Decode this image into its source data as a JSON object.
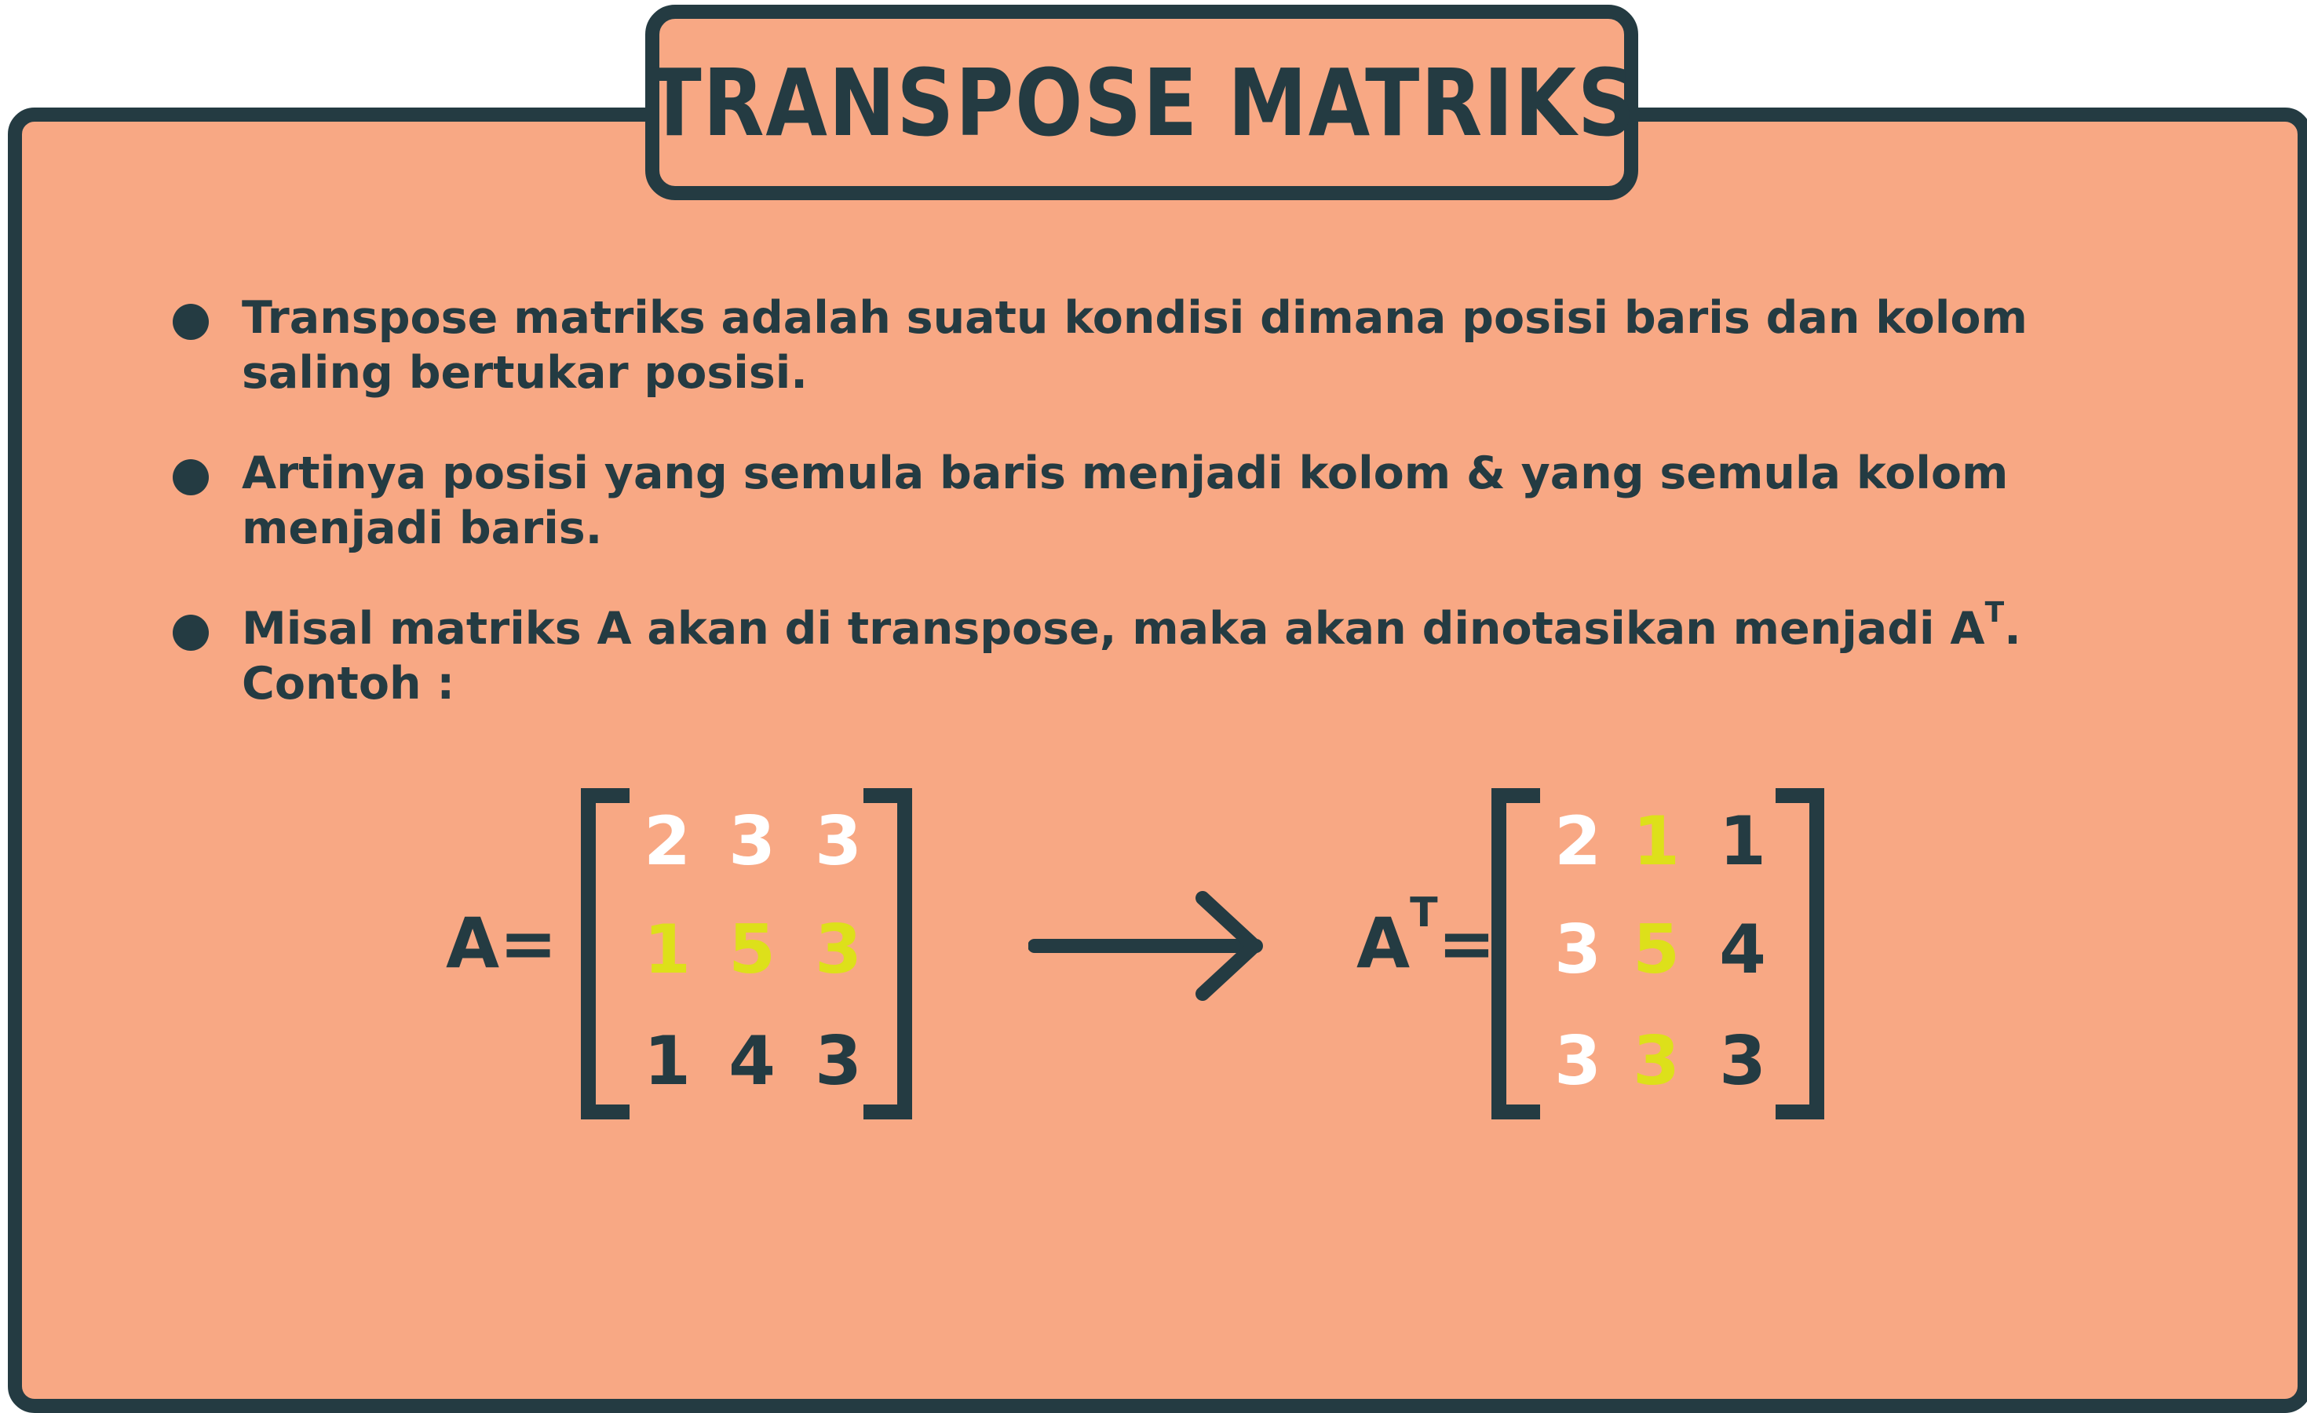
{
  "title": "TRANSPOSE MATRIKS",
  "bullets": [
    {
      "text": "Transpose matriks adalah suatu kondisi dimana posisi baris dan kolom saling bertukar posisi."
    },
    {
      "text": "Artinya posisi yang semula baris menjadi kolom & yang semula kolom menjadi baris."
    },
    {
      "text_before": "Misal matriks A akan di transpose, maka akan dinotasikan menjadi A",
      "superscript": "T",
      "text_after": ". Contoh :"
    }
  ],
  "matrix_a": {
    "label": "A=",
    "rows": [
      [
        "2",
        "3",
        "3"
      ],
      [
        "1",
        "5",
        "3"
      ],
      [
        "1",
        "4",
        "3"
      ]
    ],
    "colors": [
      [
        "white",
        "white",
        "white"
      ],
      [
        "yellow",
        "yellow",
        "yellow"
      ],
      [
        "dark",
        "dark",
        "dark"
      ]
    ]
  },
  "matrix_at": {
    "label_base": "A",
    "label_sup": "T",
    "label_eq": "=",
    "rows": [
      [
        "2",
        "1",
        "1"
      ],
      [
        "3",
        "5",
        "4"
      ],
      [
        "3",
        "3",
        "3"
      ]
    ],
    "colors": [
      [
        "white",
        "yellow",
        "dark"
      ],
      [
        "white",
        "yellow",
        "dark"
      ],
      [
        "white",
        "yellow",
        "dark"
      ]
    ]
  },
  "palette": {
    "background": "#f8a884",
    "dark": "#243b42",
    "white": "#ffffff",
    "yellow": "#dde01a"
  },
  "icons": {
    "arrow": "right-arrow-icon",
    "bullet": "bullet-dot-icon"
  }
}
